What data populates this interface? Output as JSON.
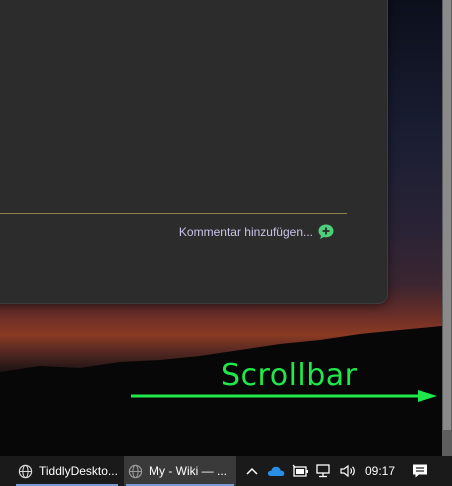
{
  "window": {
    "add_comment_label": "Kommentar hinzufügen..."
  },
  "annotation": {
    "label": "Scrollbar",
    "color": "#1fe84a"
  },
  "taskbar": {
    "apps": [
      {
        "label": "TiddlyDeskto...",
        "icon": "globe-icon",
        "active": false
      },
      {
        "label": "My - Wiki — ...",
        "icon": "globe-icon",
        "active": true
      }
    ],
    "tray_icons": [
      "chevron-up-icon",
      "onedrive-cloud-icon",
      "battery-icon",
      "network-icon",
      "volume-icon"
    ],
    "clock": "09:17",
    "notification_icon": "action-center-icon"
  }
}
